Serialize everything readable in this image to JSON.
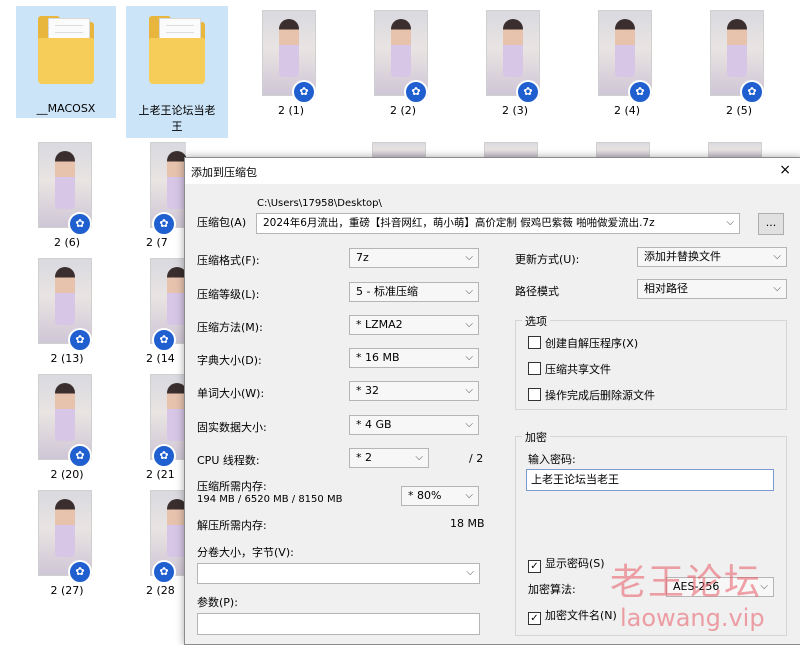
{
  "desktop": {
    "folders": [
      {
        "label": "__MACOSX"
      },
      {
        "label_line1": "上老王论坛当老",
        "label_line2": "王"
      }
    ],
    "thumbs_row1": [
      "2 (1)",
      "2 (2)",
      "2 (3)",
      "2 (4)",
      "2 (5)"
    ],
    "thumbs_col1": [
      "2 (6)",
      "2 (13)",
      "2 (20)",
      "2 (27)"
    ],
    "thumbs_col2": [
      "2 (7",
      "2 (14",
      "2 (21",
      "2 (28"
    ]
  },
  "dialog": {
    "title": "添加到压缩包",
    "close": "×",
    "archive_label": "压缩包(A)",
    "archive_path": "C:\\Users\\17958\\Desktop\\",
    "archive_name": "2024年6月流出，重磅【抖音网红，萌小萌】高价定制 假鸡巴紫薇 啪啪做爱流出.7z",
    "browse": "...",
    "format_label": "压缩格式(F):",
    "format_value": "7z",
    "level_label": "压缩等级(L):",
    "level_value": "5 - 标准压缩",
    "method_label": "压缩方法(M):",
    "method_value": "* LZMA2",
    "dict_label": "字典大小(D):",
    "dict_value": "* 16 MB",
    "word_label": "单词大小(W):",
    "word_value": "* 32",
    "solid_label": "固实数据大小:",
    "solid_value": "* 4 GB",
    "cpu_label": "CPU 线程数:",
    "cpu_value": "* 2",
    "cpu_total": "/ 2",
    "mem_label": "压缩所需内存:",
    "mem_value": "194 MB / 6520 MB / 8150 MB",
    "mem_pct": "* 80%",
    "decomp_label": "解压所需内存:",
    "decomp_value": "18 MB",
    "split_label": "分卷大小，字节(V):",
    "params_label": "参数(P):",
    "update_label": "更新方式(U):",
    "update_value": "添加并替换文件",
    "pathmode_label": "路径模式",
    "pathmode_value": "相对路径",
    "options_title": "选项",
    "opt_sfx": "创建自解压程序(X)",
    "opt_shared": "压缩共享文件",
    "opt_delete": "操作完成后删除源文件",
    "enc_title": "加密",
    "pwd_label": "输入密码:",
    "pwd_value": "上老王论坛当老王",
    "show_pwd": "显示密码(S)",
    "enc_method_label": "加密算法:",
    "enc_method_value": "AES-256",
    "enc_names": "加密文件名(N)",
    "check": "✓"
  },
  "watermark": {
    "cn": "老王论坛",
    "url": "laowang.vip"
  }
}
